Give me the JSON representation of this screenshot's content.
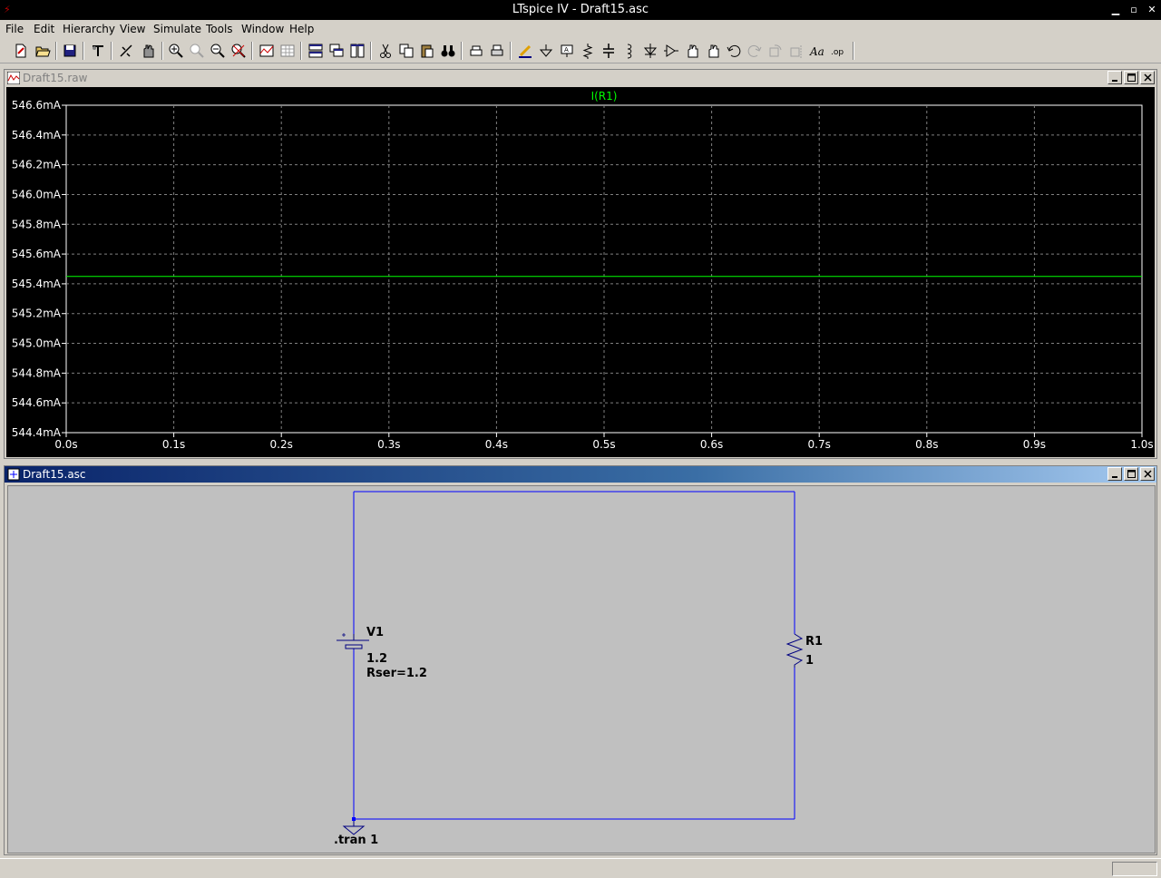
{
  "window": {
    "title": "LTspice IV - Draft15.asc"
  },
  "menu": {
    "items": [
      {
        "label": "File"
      },
      {
        "label": "Edit"
      },
      {
        "label": "Hierarchy"
      },
      {
        "label": "View"
      },
      {
        "label": "Simulate"
      },
      {
        "label": "Tools"
      },
      {
        "label": "Window"
      },
      {
        "label": "Help"
      }
    ]
  },
  "plot_window": {
    "title": "Draft15.raw"
  },
  "schematic_window": {
    "title": "Draft15.asc",
    "components": {
      "source_name": "V1",
      "source_value": "1.2",
      "source_param": "Rser=1.2",
      "resistor_name": "R1",
      "resistor_value": "1",
      "directive": ".tran 1"
    }
  },
  "colors": {
    "trace": "#00ff00",
    "wire": "#0000ff",
    "plot_bg": "#000000",
    "schematic_bg": "#c0c0c0"
  },
  "chart_data": {
    "type": "line",
    "title": "I(R1)",
    "xlabel": "",
    "ylabel": "",
    "x_ticks": [
      "0.0s",
      "0.1s",
      "0.2s",
      "0.3s",
      "0.4s",
      "0.5s",
      "0.6s",
      "0.7s",
      "0.8s",
      "0.9s",
      "1.0s"
    ],
    "y_ticks": [
      "546.6mA",
      "546.4mA",
      "546.2mA",
      "546.0mA",
      "545.8mA",
      "545.6mA",
      "545.4mA",
      "545.2mA",
      "545.0mA",
      "544.8mA",
      "544.6mA",
      "544.4mA"
    ],
    "xlim": [
      0,
      1
    ],
    "ylim": [
      544.4,
      546.6
    ],
    "grid": true,
    "series": [
      {
        "name": "I(R1)",
        "x": [
          0,
          1
        ],
        "y": [
          545.45,
          545.45
        ]
      }
    ]
  }
}
